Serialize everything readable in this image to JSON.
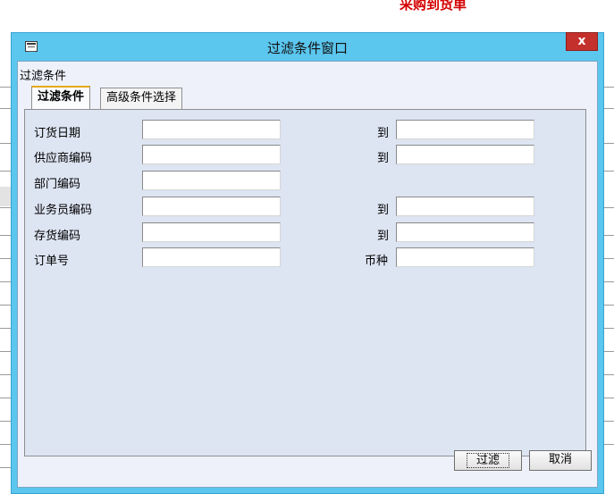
{
  "background": {
    "title": "采购到货单"
  },
  "dialog": {
    "title": "过滤条件窗口",
    "close_label": "x",
    "group_label": "过滤条件",
    "tabs": [
      {
        "label": "过滤条件",
        "active": true
      },
      {
        "label": "高级条件选择",
        "active": false
      }
    ],
    "fields": {
      "order_date": {
        "label": "订货日期",
        "value": "",
        "to_label": "到",
        "to_value": ""
      },
      "supplier_code": {
        "label": "供应商编码",
        "value": "",
        "to_label": "到",
        "to_value": ""
      },
      "dept_code": {
        "label": "部门编码",
        "value": ""
      },
      "salesman_code": {
        "label": "业务员编码",
        "value": "",
        "to_label": "到",
        "to_value": ""
      },
      "inventory_code": {
        "label": "存货编码",
        "value": "",
        "to_label": "到",
        "to_value": ""
      },
      "order_no": {
        "label": "订单号",
        "value": "",
        "currency_label": "币种",
        "currency_value": ""
      }
    },
    "buttons": {
      "filter": "过滤",
      "cancel": "取消"
    }
  }
}
